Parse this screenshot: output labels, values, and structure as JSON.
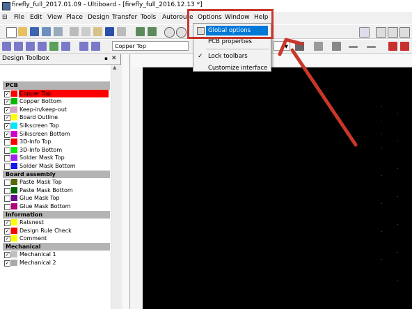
{
  "window": {
    "title": "firefly_full_2017.01.09 - Ultiboard - [firefly_full_2016.12.13 *]"
  },
  "menubar": {
    "items": [
      "File",
      "Edit",
      "View",
      "Place",
      "Design",
      "Transfer",
      "Tools",
      "Autoroute",
      "Options",
      "Window",
      "Help"
    ]
  },
  "toolbar": {
    "layer_select": "Copper Top"
  },
  "options_menu": {
    "items": [
      "Global options",
      "PCB properties",
      "Lock toolbars",
      "Customize interface"
    ],
    "highlighted": "Global options",
    "checked": "Lock toolbars"
  },
  "toolbox": {
    "title": "Design Toolbox",
    "sections": [
      {
        "name": "PCB",
        "layers": [
          {
            "name": "Copper Top",
            "checked": true,
            "color": "#ff0000",
            "selected": true
          },
          {
            "name": "Copper Bottom",
            "checked": true,
            "color": "#00bb00"
          },
          {
            "name": "Keep-in/keep-out",
            "checked": true,
            "color": "#d7a2c8"
          },
          {
            "name": "Board Outline",
            "checked": true,
            "color": "#ffff00"
          },
          {
            "name": "Silkscreen Top",
            "checked": true,
            "color": "#00e8ff"
          },
          {
            "name": "Silkscreen Bottom",
            "checked": true,
            "color": "#d000d0"
          },
          {
            "name": "3D-Info Top",
            "checked": false,
            "color": "#ff0000"
          },
          {
            "name": "3D-Info Bottom",
            "checked": false,
            "color": "#00ee00"
          },
          {
            "name": "Solder Mask Top",
            "checked": false,
            "color": "#a020f0"
          },
          {
            "name": "Solder Mask Bottom",
            "checked": false,
            "color": "#1818ee"
          }
        ]
      },
      {
        "name": "Board assembly",
        "layers": [
          {
            "name": "Paste Mask Top",
            "checked": false,
            "color": "#556b00"
          },
          {
            "name": "Paste Mask Bottom",
            "checked": false,
            "color": "#006400"
          },
          {
            "name": "Glue Mask Top",
            "checked": false,
            "color": "#6a0d8a"
          },
          {
            "name": "Glue Mask Bottom",
            "checked": false,
            "color": "#b0007a"
          }
        ]
      },
      {
        "name": "Information",
        "layers": [
          {
            "name": "Ratsnest",
            "checked": true,
            "color": "#ffff00"
          },
          {
            "name": "Design Rule Check",
            "checked": true,
            "color": "#ff0000"
          },
          {
            "name": "Comment",
            "checked": true,
            "color": "#ffff00"
          }
        ]
      },
      {
        "name": "Mechanical",
        "layers": [
          {
            "name": "Mechanical 1",
            "checked": true,
            "color": "#c0c0c0"
          },
          {
            "name": "Mechanical 2",
            "checked": true,
            "color": "#a9a9a9"
          }
        ]
      }
    ]
  },
  "colors": {
    "annotation": "#c8372a",
    "menu_highlight": "#0078d7",
    "selected_layer": "#ff0000",
    "canvas": "#000000"
  }
}
